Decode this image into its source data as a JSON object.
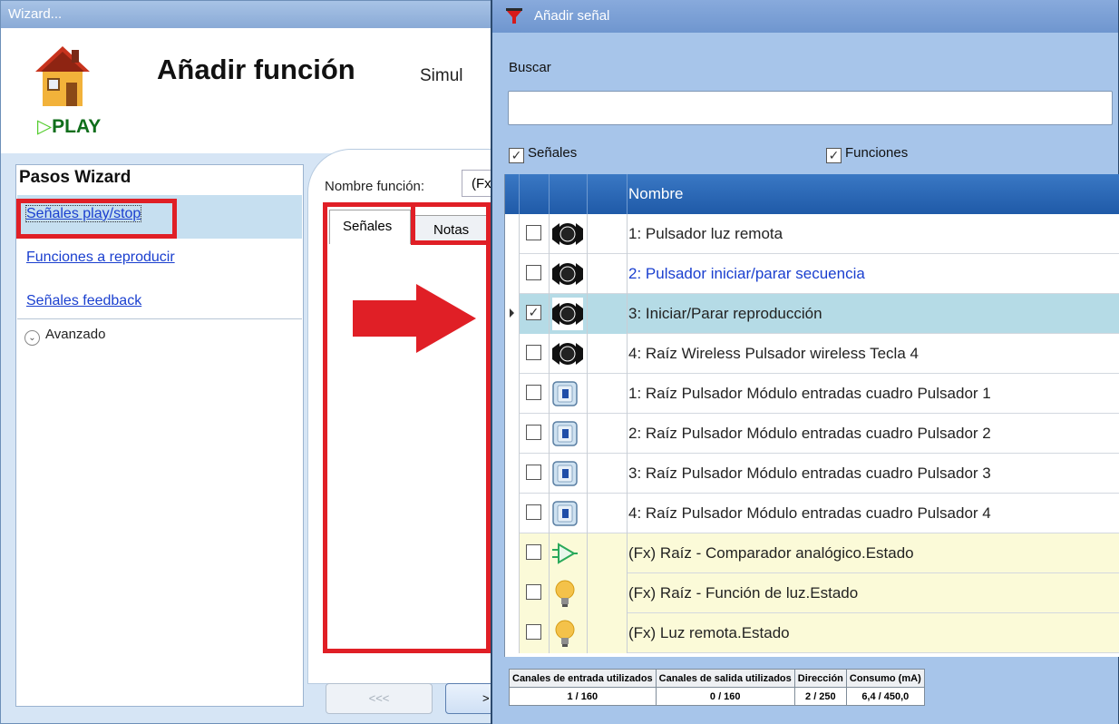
{
  "wizard": {
    "window_title": "Wizard...",
    "title": "Añadir función",
    "subtitle": "Simul",
    "logo_text": "PLAY",
    "steps_title": "Pasos Wizard",
    "steps": [
      {
        "label": "Señales play/stop",
        "active": true
      },
      {
        "label": "Funciones a reproducir",
        "active": false
      },
      {
        "label": "Señales feedback",
        "active": false
      }
    ],
    "advanced_label": "Avanzado",
    "function_name_label": "Nombre función:",
    "function_name_value": "(Fx",
    "tabs": [
      "Señales",
      "Notas"
    ],
    "back_button": "<<<",
    "next_button": ">"
  },
  "dialog": {
    "title": "Añadir señal",
    "search_label": "Buscar",
    "search_value": "",
    "filter_signals": {
      "label": "Señales",
      "checked": true
    },
    "filter_functions": {
      "label": "Funciones",
      "checked": true
    },
    "grid_header": "Nombre",
    "rows": [
      {
        "text": "1: Pulsador luz remota",
        "icon": "pushbutton-icon",
        "checked": false,
        "style": "normal"
      },
      {
        "text": "2: Pulsador iniciar/parar secuencia",
        "icon": "pushbutton-icon",
        "checked": false,
        "style": "link"
      },
      {
        "text": "3: Iniciar/Parar reproducción",
        "icon": "pushbutton-icon",
        "checked": true,
        "style": "selected"
      },
      {
        "text": "4: Raíz Wireless Pulsador wireless Tecla 4",
        "icon": "pushbutton-icon",
        "checked": false,
        "style": "normal"
      },
      {
        "text": "1: Raíz Pulsador Módulo entradas cuadro Pulsador 1",
        "icon": "input-module-icon",
        "checked": false,
        "style": "normal"
      },
      {
        "text": "2: Raíz Pulsador Módulo entradas cuadro Pulsador 2",
        "icon": "input-module-icon",
        "checked": false,
        "style": "normal"
      },
      {
        "text": "3: Raíz Pulsador Módulo entradas cuadro Pulsador 3",
        "icon": "input-module-icon",
        "checked": false,
        "style": "normal"
      },
      {
        "text": "4: Raíz Pulsador Módulo entradas cuadro Pulsador 4",
        "icon": "input-module-icon",
        "checked": false,
        "style": "normal"
      },
      {
        "text": "(Fx) Raíz - Comparador analógico.Estado",
        "icon": "comparator-icon",
        "checked": false,
        "style": "fx"
      },
      {
        "text": "(Fx) Raíz - Función de luz.Estado",
        "icon": "lightbulb-icon",
        "checked": false,
        "style": "fx"
      },
      {
        "text": "(Fx) Luz remota.Estado",
        "icon": "lightbulb-icon",
        "checked": false,
        "style": "fx"
      }
    ],
    "footer": {
      "headers": [
        "Canales de entrada utilizados",
        "Canales de salida utilizados",
        "Dirección",
        "Consumo (mA)"
      ],
      "values": [
        "1 / 160",
        "0 / 160",
        "2 / 250",
        "6,4 / 450,0"
      ]
    }
  },
  "colors": {
    "highlight": "#e01f26",
    "selected_row": "#b5dbe6",
    "fx_row": "#fbfad8",
    "header_blue": "#2a67b6",
    "link_blue": "#1a3fcf"
  }
}
